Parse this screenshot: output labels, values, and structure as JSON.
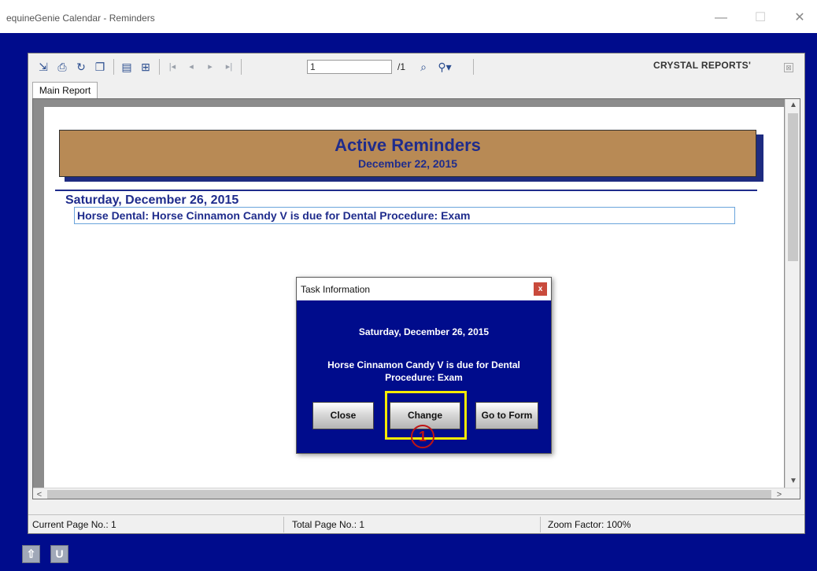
{
  "window": {
    "title": "equineGenie  Calendar - Reminders",
    "minimize_glyph": "—",
    "maximize_glyph": "☐",
    "close_glyph": "✕"
  },
  "toolbar": {
    "icons": [
      "export-icon",
      "print-icon",
      "refresh-icon",
      "copy-icon",
      "toggle-group-tree-icon",
      "group-tree-icon",
      "first-page-icon",
      "previous-page-icon",
      "next-page-icon",
      "last-page-icon",
      "search-icon",
      "zoom-icon"
    ],
    "page_input_value": "1",
    "page_total": "/1",
    "brand": "CRYSTAL REPORTS'",
    "brand_close": "⊠"
  },
  "tabs": [
    {
      "label": "Main Report"
    }
  ],
  "report": {
    "title": "Active Reminders",
    "date": "December 22, 2015",
    "day_header": "Saturday, December 26, 2015",
    "reminder": "Horse Dental: Horse Cinnamon Candy V is due for Dental Procedure: Exam"
  },
  "dialog": {
    "title": "Task Information",
    "close_glyph": "x",
    "date": "Saturday, December 26, 2015",
    "message": "Horse Cinnamon Candy V is due for Dental Procedure: Exam",
    "buttons": {
      "close": "Close",
      "change": "Change",
      "go_to_form": "Go to Form"
    },
    "step_marker": "1"
  },
  "status": {
    "current_page": "Current Page No.: 1",
    "total_page": "Total Page No.: 1",
    "zoom": "Zoom Factor: 100%"
  },
  "scroll": {
    "up": "▲",
    "down": "▼",
    "left": "<",
    "right": ">"
  },
  "nav": {
    "up_glyph": "⇧",
    "undo_glyph": "U"
  },
  "colors": {
    "background_blue": "#000c8c",
    "banner_tan": "#b88a55",
    "report_text_blue": "#1f2c8c",
    "highlight_yellow": "#f5ea00",
    "marker_red": "#c01414"
  }
}
